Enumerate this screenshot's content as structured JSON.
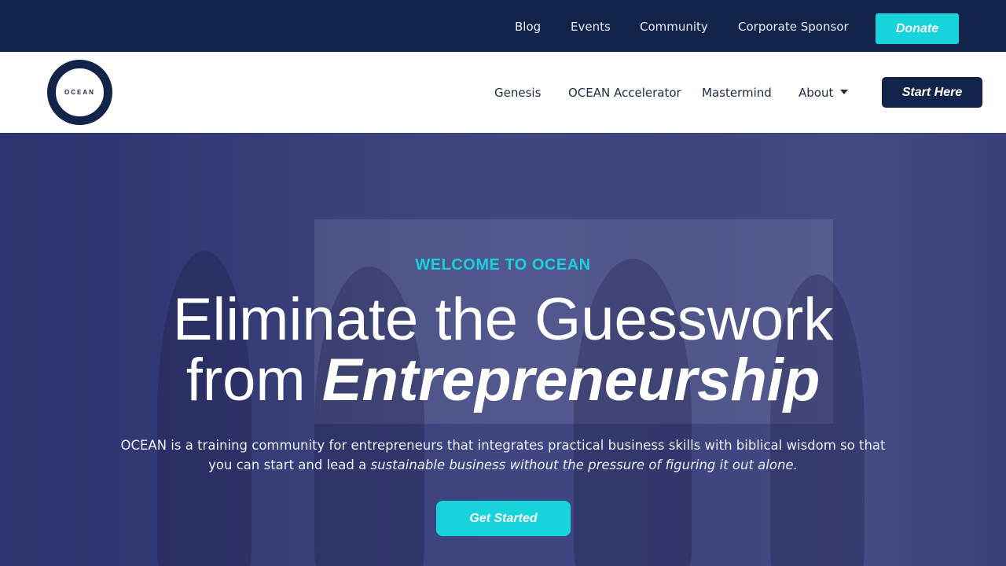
{
  "top_nav": {
    "items": [
      "Blog",
      "Events",
      "Community",
      "Corporate Sponsor"
    ],
    "donate_label": "Donate"
  },
  "header": {
    "logo_text": "OCEAN",
    "nav": [
      "Genesis",
      "OCEAN Accelerator",
      "Mastermind",
      "About"
    ],
    "start_label": "Start Here"
  },
  "hero": {
    "eyebrow": "WELCOME TO OCEAN",
    "headline_line1": "Eliminate the Guesswork",
    "headline_line2_plain": "from ",
    "headline_line2_emphasis": "Entrepreneurship",
    "subtext_plain": "OCEAN is a training community for entrepreneurs that integrates practical business skills with biblical wisdom so that you can start and lead a ",
    "subtext_emphasis": "sustainable business without the pressure of figuring it out alone.",
    "cta_label": "Get Started"
  },
  "colors": {
    "navy": "#13244a",
    "accent": "#17d3dc",
    "hero_overlay": "#2c3478"
  }
}
